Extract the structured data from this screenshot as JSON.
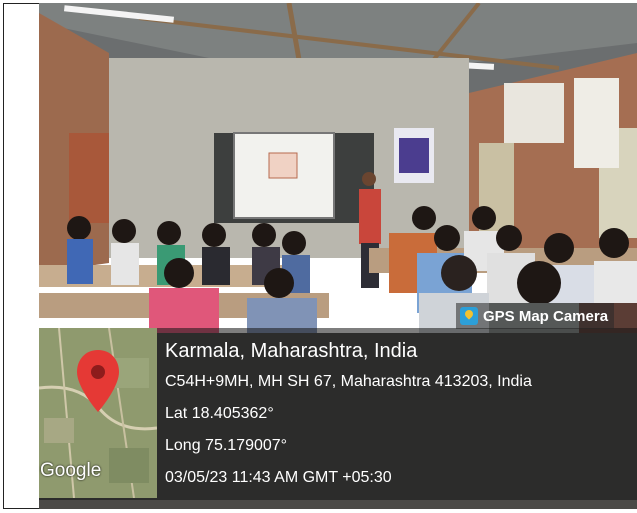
{
  "gps_badge": {
    "label": "GPS Map Camera"
  },
  "location": {
    "title": "Karmala, Maharashtra, India",
    "address": "C54H+9MH, MH SH 67, Maharashtra 413203, India",
    "lat": "Lat 18.405362°",
    "long": "Long 75.179007°",
    "datetime": "03/05/23 11:43 AM GMT +05:30"
  },
  "map": {
    "brand": "Google",
    "pin_color": "#e53935"
  },
  "icons": {
    "badge_icon": "gps-map-camera-icon",
    "pin_icon": "map-pin-icon"
  }
}
